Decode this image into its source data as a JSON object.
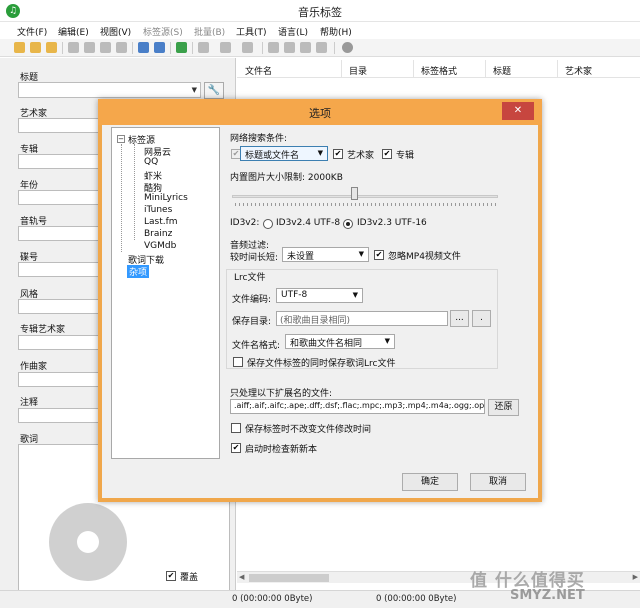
{
  "window": {
    "title": "音乐标签"
  },
  "menu": [
    {
      "label": "文件(F)"
    },
    {
      "label": "编辑(E)"
    },
    {
      "label": "视图(V)"
    },
    {
      "label": "标签源(S)",
      "disabled": true
    },
    {
      "label": "批量(B)",
      "disabled": true
    },
    {
      "label": "工具(T)"
    },
    {
      "label": "语言(L)"
    },
    {
      "label": "帮助(H)"
    }
  ],
  "left_fields": {
    "title": "标题",
    "artist": "艺术家",
    "album": "专辑",
    "year": "年份",
    "track": "音轨号",
    "disc": "碟号",
    "genre": "风格",
    "album_artist": "专辑艺术家",
    "composer": "作曲家",
    "comment": "注释",
    "lyrics": "歌词"
  },
  "cover": {
    "overwrite_label": "覆盖",
    "overwrite_checked": "✔"
  },
  "columns": [
    "文件名",
    "目录",
    "标签格式",
    "标题",
    "艺术家"
  ],
  "status": {
    "left": "0 (00:00:00 0Byte)",
    "right": "0 (00:00:00 0Byte)"
  },
  "watermark": {
    "text": "值 什么值得买",
    "sub": "SMYZ.NET"
  },
  "dialog": {
    "title": "选项",
    "close_glyph": "✕",
    "tree": {
      "root": "标签源",
      "sources": [
        "网易云",
        "QQ",
        "虾米",
        "酷狗",
        "MiniLyrics",
        "iTunes",
        "Last.fm",
        "Brainz",
        "VGMdb"
      ],
      "lyrics_download": "歌词下载",
      "misc": "杂项"
    },
    "network_search": {
      "heading": "网络搜索条件:",
      "select_value": "标题或文件名",
      "artist_label": "艺术家",
      "artist_checked": "✔",
      "album_label": "专辑",
      "album_checked": "✔",
      "title_checked": "✔"
    },
    "image_limit": {
      "label": "内置图片大小限制: 2000KB",
      "value_kb": 2000,
      "fraction": 0.46
    },
    "id3v2": {
      "label": "ID3v2:",
      "opt1": "ID3v2.4 UTF-8",
      "opt2": "ID3v2.3 UTF-16",
      "selected": "ID3v2.3 UTF-16"
    },
    "audio_filter": {
      "heading": "音频过滤:",
      "duration_label": "较时间长短:",
      "duration_value": "未设置",
      "ignore_mp4_label": "忽略MP4视频文件",
      "ignore_mp4_checked": "✔"
    },
    "lrc": {
      "heading": "Lrc文件",
      "encoding_label": "文件编码:",
      "encoding_value": "UTF-8",
      "save_dir_label": "保存目录:",
      "save_dir_placeholder": "(和歌曲目录相同)",
      "browse_label": "...",
      "dot_label": ".",
      "filename_label": "文件名格式:",
      "filename_value": "和歌曲文件名相同",
      "save_with_tag_label": "保存文件标签的同时保存歌词Lrc文件"
    },
    "ext_filter": {
      "heading": "只处理以下扩展名的文件:",
      "value": ".aiff;.aif;.aifc;.ape;.dff;.dsf;.flac;.mpc;.mp3;.mp4;.m4a;.ogg;.opus",
      "restore_label": "还原"
    },
    "keep_mtime_label": "保存标签时不改变文件修改时间",
    "check_update_label": "启动时检查新新本",
    "check_update_checked": "✔",
    "ok_label": "确定",
    "cancel_label": "取消"
  }
}
